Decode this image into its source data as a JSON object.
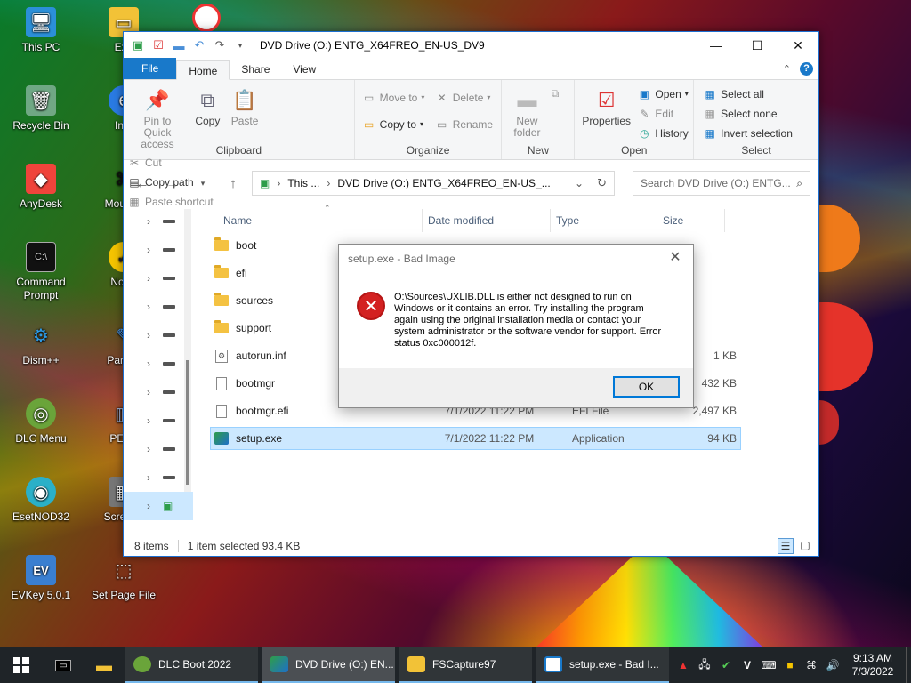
{
  "desktop": {
    "icons": [
      {
        "label": "This PC"
      },
      {
        "label": "Recycle Bin"
      },
      {
        "label": "AnyDesk"
      },
      {
        "label": "Command Prompt"
      },
      {
        "label": "Dism++"
      },
      {
        "label": "DLC Menu"
      },
      {
        "label": "EsetNOD32"
      },
      {
        "label": "EVKey 5.0.1"
      },
      {
        "label": "Exp"
      },
      {
        "label": "Inte"
      },
      {
        "label": "Mouse I"
      },
      {
        "label": "Norto"
      },
      {
        "label": "Partitio"
      },
      {
        "label": "PENe"
      },
      {
        "label": "Screen I"
      },
      {
        "label": "Set Page File"
      }
    ]
  },
  "explorer": {
    "title": "DVD Drive (O:) ENTG_X64FREO_EN-US_DV9",
    "tabs": {
      "file": "File",
      "home": "Home",
      "share": "Share",
      "view": "View"
    },
    "ribbon": {
      "clipboard": {
        "pin": "Pin to Quick access",
        "copy": "Copy",
        "paste": "Paste",
        "cut": "Cut",
        "copy_path": "Copy path",
        "paste_shortcut": "Paste shortcut",
        "group": "Clipboard"
      },
      "organize": {
        "move_to": "Move to",
        "copy_to": "Copy to",
        "delete": "Delete",
        "rename": "Rename",
        "group": "Organize"
      },
      "new": {
        "new_folder": "New folder",
        "group": "New"
      },
      "open": {
        "properties": "Properties",
        "open": "Open",
        "edit": "Edit",
        "history": "History",
        "group": "Open"
      },
      "select": {
        "select_all": "Select all",
        "select_none": "Select none",
        "invert": "Invert selection",
        "group": "Select"
      }
    },
    "address": {
      "this_pc": "This ...",
      "current": "DVD Drive (O:) ENTG_X64FREO_EN-US_..."
    },
    "search_placeholder": "Search DVD Drive (O:) ENTG...",
    "columns": {
      "name": "Name",
      "date": "Date modified",
      "type": "Type",
      "size": "Size"
    },
    "files": [
      {
        "name": "boot",
        "date": "",
        "type": "",
        "size": ""
      },
      {
        "name": "efi",
        "date": "",
        "type": "",
        "size": ""
      },
      {
        "name": "sources",
        "date": "",
        "type": "",
        "size": ""
      },
      {
        "name": "support",
        "date": "",
        "type": "",
        "size": ""
      },
      {
        "name": "autorun.inf",
        "date": "",
        "type": "",
        "size": "1 KB"
      },
      {
        "name": "bootmgr",
        "date": "",
        "type": "",
        "size": "432 KB"
      },
      {
        "name": "bootmgr.efi",
        "date": "7/1/2022 11:22 PM",
        "type": "EFI File",
        "size": "2,497 KB"
      },
      {
        "name": "setup.exe",
        "date": "7/1/2022 11:22 PM",
        "type": "Application",
        "size": "94 KB"
      }
    ],
    "status": {
      "items": "8 items",
      "selected": "1 item selected  93.4 KB"
    }
  },
  "dialog": {
    "title": "setup.exe - Bad Image",
    "message": "O:\\Sources\\UXLIB.DLL is either not designed to run on Windows or it contains an error. Try installing the program again using the original installation media or contact your system administrator or the software vendor for support. Error status 0xc000012f.",
    "ok": "OK"
  },
  "taskbar": {
    "items": [
      {
        "label": "DLC Boot 2022"
      },
      {
        "label": "DVD Drive (O:) EN..."
      },
      {
        "label": "FSCapture97"
      },
      {
        "label": "setup.exe - Bad I..."
      }
    ],
    "time": "9:13 AM",
    "date": "7/3/2022"
  }
}
